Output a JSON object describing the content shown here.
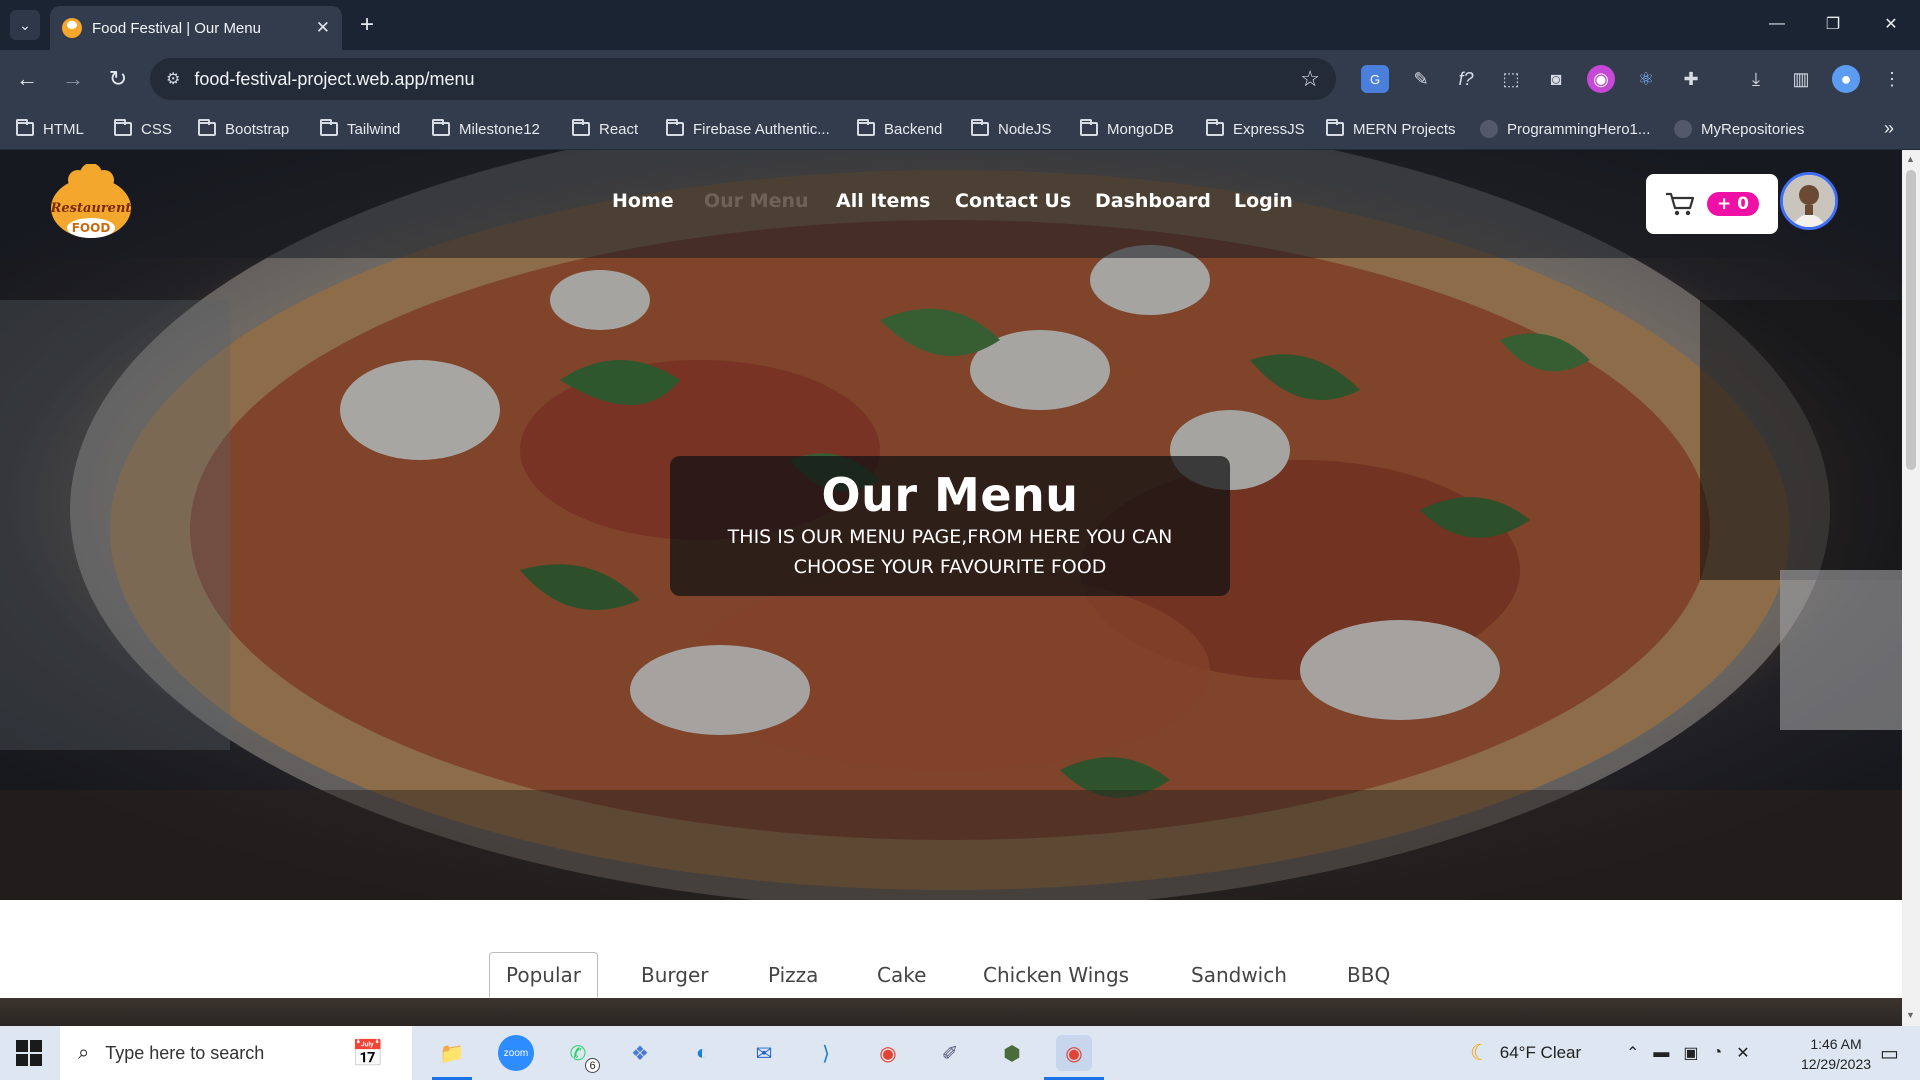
{
  "browser": {
    "tab_title": "Food Festival | Our Menu",
    "url": "food-festival-project.web.app/menu",
    "bookmarks": [
      {
        "label": "HTML",
        "type": "folder"
      },
      {
        "label": "CSS",
        "type": "folder"
      },
      {
        "label": "Bootstrap",
        "type": "folder"
      },
      {
        "label": "Tailwind",
        "type": "folder"
      },
      {
        "label": "Milestone12",
        "type": "folder"
      },
      {
        "label": "React",
        "type": "folder"
      },
      {
        "label": "Firebase Authentic...",
        "type": "folder"
      },
      {
        "label": "Backend",
        "type": "folder"
      },
      {
        "label": "NodeJS",
        "type": "folder"
      },
      {
        "label": "MongoDB",
        "type": "folder"
      },
      {
        "label": "ExpressJS",
        "type": "folder"
      },
      {
        "label": "MERN Projects",
        "type": "folder"
      },
      {
        "label": "ProgrammingHero1...",
        "type": "github"
      },
      {
        "label": "MyRepositories",
        "type": "github"
      }
    ]
  },
  "site": {
    "logo_text_top": "Restaurent",
    "logo_text_bottom": "FOOD",
    "nav": {
      "home": "Home",
      "our_menu": "Our Menu",
      "all_items": "All Items",
      "contact": "Contact Us",
      "dashboard": "Dashboard",
      "login": "Login"
    },
    "cart_count": "+ 0",
    "banner": {
      "title": "Our Menu",
      "subtitle": "THIS IS OUR MENU PAGE,FROM HERE YOU CAN CHOOSE YOUR FAVOURITE FOOD"
    },
    "menu_tabs": [
      "Popular",
      "Burger",
      "Pizza",
      "Cake",
      "Chicken Wings",
      "Sandwich",
      "BBQ"
    ],
    "active_tab": "Popular"
  },
  "taskbar": {
    "search_placeholder": "Type here to search",
    "whatsapp_badge": "6",
    "weather": "64°F  Clear",
    "time": "1:46 AM",
    "date": "12/29/2023"
  },
  "colors": {
    "cart_badge": "#f010a6",
    "avatar_ring": "#3f6ef7",
    "logo": "#f3a72c"
  }
}
